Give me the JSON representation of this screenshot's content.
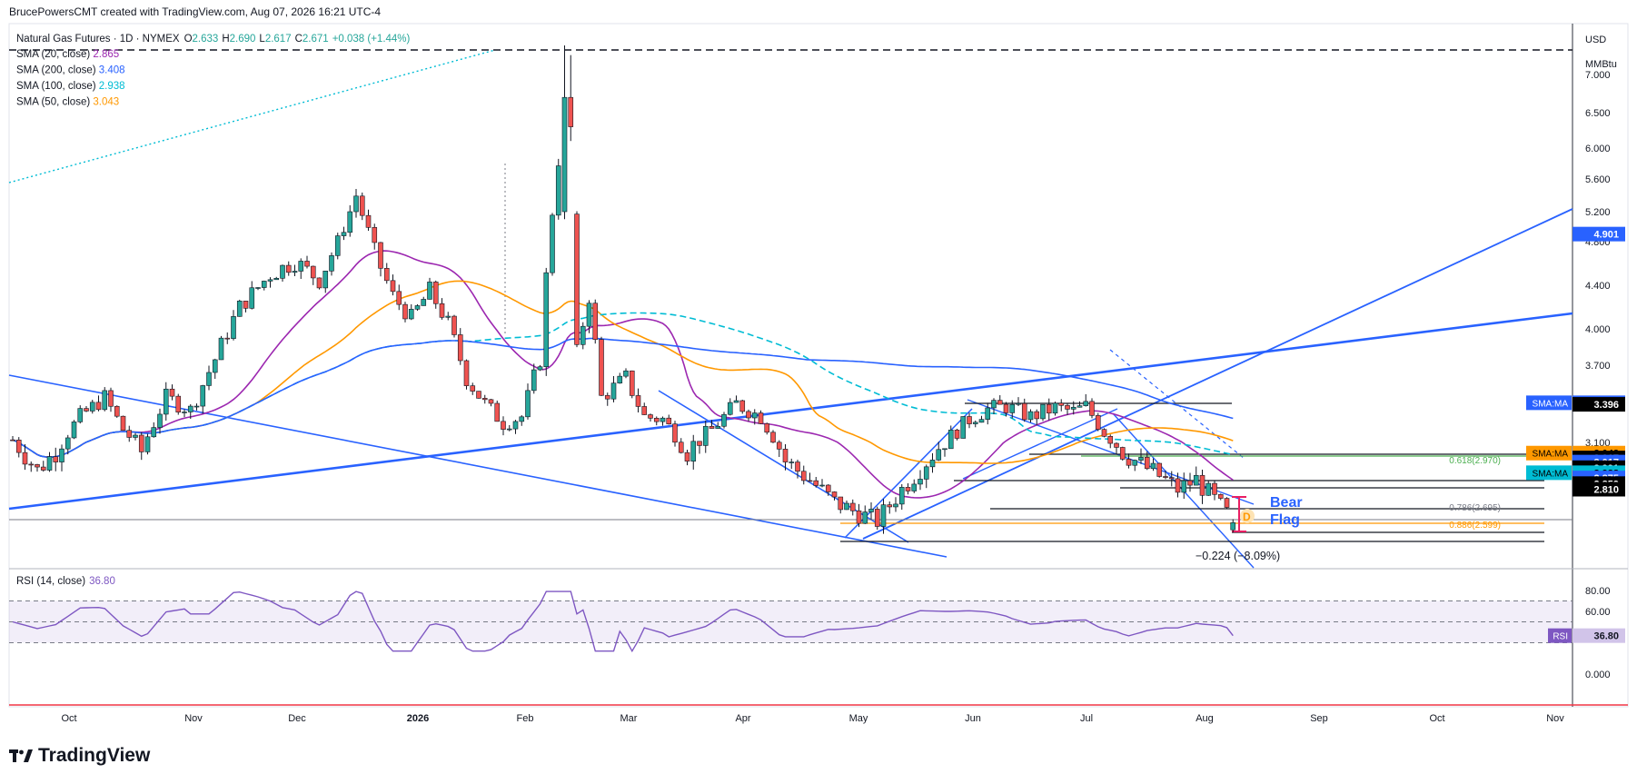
{
  "header": {
    "credit": "BrucePowersCMT created with TradingView.com, Aug 07, 2026 16:21 UTC-4",
    "symbol": "Natural Gas Futures · 1D · NYMEX",
    "ohlc": {
      "o_label": "O",
      "o": "2.633",
      "h_label": "H",
      "h": "2.690",
      "l_label": "L",
      "l": "2.617",
      "c_label": "C",
      "c": "2.671",
      "change": "+0.038 (+1.44%)"
    }
  },
  "legend": [
    {
      "label": "SMA (20, close)",
      "value": "2.865",
      "color": "#9c27b0"
    },
    {
      "label": "SMA (200, close)",
      "value": "3.408",
      "color": "#2962ff"
    },
    {
      "label": "SMA (100, close)",
      "value": "2.938",
      "color": "#00bcd4"
    },
    {
      "label": "SMA (50, close)",
      "value": "3.043",
      "color": "#ff9800"
    }
  ],
  "price_axis": {
    "unit": "USD",
    "unit2": "MMBtu",
    "ticks": [
      "7.000",
      "6.500",
      "6.000",
      "5.600",
      "5.200",
      "4.800",
      "4.400",
      "4.000",
      "3.700",
      "3.100"
    ]
  },
  "price_labels": [
    {
      "text": "4.901",
      "value": 4.901,
      "bg": "#2962ff",
      "fg": "#ffffff"
    },
    {
      "text": "3.408",
      "value": 3.408,
      "bg": "#2962ff",
      "fg": "#ffffff",
      "tag": "SMA:MA"
    },
    {
      "text": "3.396",
      "value": 3.396,
      "bg": "#000000",
      "fg": "#ffffff"
    },
    {
      "text": "3.043",
      "value": 3.043,
      "bg": "#ff9800",
      "fg": "#000000",
      "tag": "SMA:MA"
    },
    {
      "text": "3.017",
      "value": 3.017,
      "bg": "#000000",
      "fg": "#ffffff"
    },
    {
      "text": "3.017",
      "value": 2.995,
      "bg": "#2962ff",
      "fg": "#ffffff"
    },
    {
      "text": "2.991",
      "value": 2.965,
      "bg": "#000000",
      "fg": "#ffffff"
    },
    {
      "text": "2.938",
      "value": 2.938,
      "bg": "#00bcd4",
      "fg": "#000000",
      "tag": "SMA:MA"
    },
    {
      "text": "2.875",
      "value": 2.91,
      "bg": "#2962ff",
      "fg": "#ffffff"
    },
    {
      "text": "2.859",
      "value": 2.88,
      "bg": "#000000",
      "fg": "#ffffff"
    },
    {
      "text": "2.810",
      "value": 2.85,
      "bg": "#000000",
      "fg": "#ffffff"
    }
  ],
  "rsi": {
    "label": "RSI (14, close)",
    "value": "36.80",
    "tag": "RSI",
    "ticks": [
      "80.00",
      "60.00",
      "40.00",
      "0.000"
    ],
    "color": "#7e57c2"
  },
  "time_axis": [
    "Oct",
    "Nov",
    "Dec",
    "2026",
    "Feb",
    "Mar",
    "Apr",
    "May",
    "Jun",
    "Jul",
    "Aug",
    "Sep",
    "Oct",
    "Nov"
  ],
  "annotations": {
    "bear_flag_line1": "Bear",
    "bear_flag_line2": "Flag",
    "measure": "−0.224 (−8.09%)",
    "marker": "D",
    "fib_786": "0.786(2.695)",
    "fib_886": "0.886(2.599)",
    "fib_618": "0.618(2.970)"
  },
  "colors": {
    "up": "#26a69a",
    "down": "#ef5350",
    "blue": "#2962ff",
    "sma20": "#9c27b0",
    "sma50": "#ff9800",
    "sma100": "#00bcd4",
    "sma200": "#2962ff"
  },
  "chart_data": {
    "type": "candlestick",
    "series": [
      {
        "name": "SMA (20, close)",
        "last": 2.865
      },
      {
        "name": "SMA (200, close)",
        "last": 3.408
      },
      {
        "name": "SMA (100, close)",
        "last": 2.938
      },
      {
        "name": "SMA (50, close)",
        "last": 3.043
      }
    ],
    "ohlc_last": {
      "open": 2.633,
      "high": 2.69,
      "low": 2.617,
      "close": 2.671
    },
    "ylim": [
      2.6,
      7.3
    ],
    "rsi_last": 36.8,
    "approx_monthly_closes": [
      {
        "month": "Oct",
        "close": 3.0
      },
      {
        "month": "Nov",
        "close": 4.5
      },
      {
        "month": "Dec",
        "close": 4.6
      },
      {
        "month": "2026",
        "close": 3.2
      },
      {
        "month": "Feb",
        "close": 3.3
      },
      {
        "month": "Mar",
        "close": 3.1
      },
      {
        "month": "Apr",
        "close": 2.9
      },
      {
        "month": "May",
        "close": 2.95
      },
      {
        "month": "Jun",
        "close": 3.35
      },
      {
        "month": "Jul",
        "close": 3.0
      },
      {
        "month": "Aug",
        "close": 2.671
      }
    ]
  }
}
